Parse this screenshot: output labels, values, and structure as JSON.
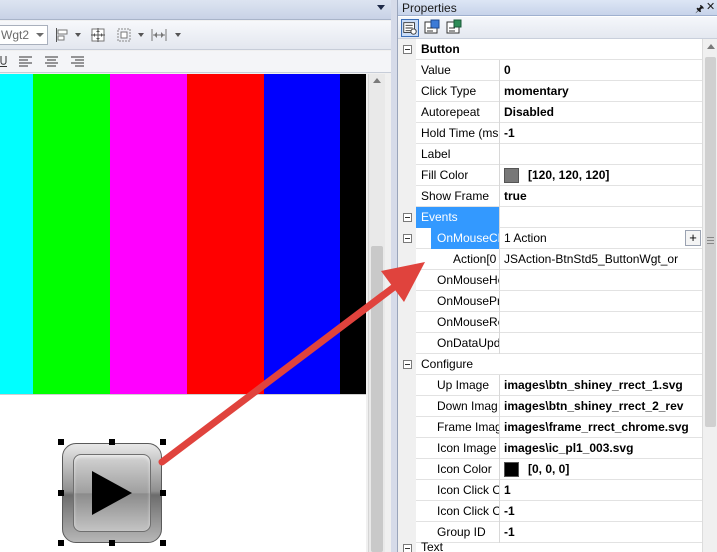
{
  "editor": {
    "widget_combo_value": "Wgt2",
    "color_bars": [
      "#00ffff",
      "#00ff00",
      "#ff00ff",
      "#ff0000",
      "#0000ff",
      "#000000"
    ]
  },
  "properties": {
    "title": "Properties",
    "categories": {
      "button": "Button",
      "events": "Events",
      "configure": "Configure",
      "text": "Text"
    },
    "rows": {
      "value": {
        "name": "Value",
        "value": "0"
      },
      "click_type": {
        "name": "Click Type",
        "value": "momentary"
      },
      "autorepeat": {
        "name": "Autorepeat",
        "value": "Disabled"
      },
      "hold_time": {
        "name": "Hold Time (ms",
        "value": "-1"
      },
      "label": {
        "name": "Label",
        "value": ""
      },
      "fill_color": {
        "name": "Fill Color",
        "value": "[120, 120, 120]",
        "swatch": "#787878"
      },
      "show_frame": {
        "name": "Show Frame",
        "value": "true"
      },
      "on_mouse_click": {
        "name": "OnMouseCl",
        "value": "1 Action"
      },
      "action0": {
        "name": "Action[0",
        "value": "JSAction-BtnStd5_ButtonWgt_or"
      },
      "on_mouse_hold": {
        "name": "OnMouseHo",
        "value": ""
      },
      "on_mouse_press": {
        "name": "OnMousePr",
        "value": ""
      },
      "on_mouse_release": {
        "name": "OnMouseRe",
        "value": ""
      },
      "on_data_update": {
        "name": "OnDataUpd",
        "value": ""
      },
      "up_image": {
        "name": "Up Image",
        "value": "images\\btn_shiney_rrect_1.svg"
      },
      "down_image": {
        "name": "Down Imag",
        "value": "images\\btn_shiney_rrect_2_rev"
      },
      "frame_image": {
        "name": "Frame Imag",
        "value": "images\\frame_rrect_chrome.svg"
      },
      "icon_image": {
        "name": "Icon Image",
        "value": "images\\ic_pl1_003.svg"
      },
      "icon_color": {
        "name": "Icon Color",
        "value": "[0, 0, 0]",
        "swatch": "#000000"
      },
      "icon_click_o1": {
        "name": "Icon Click O",
        "value": "1"
      },
      "icon_click_o2": {
        "name": "Icon Click O",
        "value": "-1"
      },
      "group_id": {
        "name": "Group ID",
        "value": "-1"
      }
    },
    "add_button_label": "+"
  },
  "colors": {
    "selection": "#3399ff",
    "arrow": "#e0433d"
  }
}
